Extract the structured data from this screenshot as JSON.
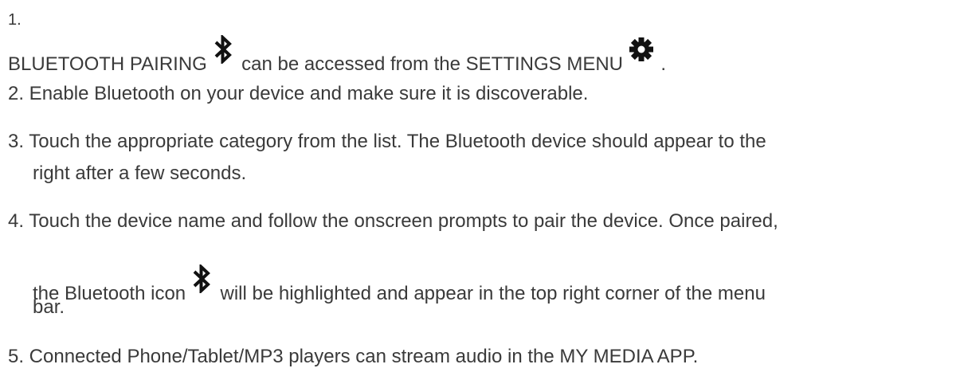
{
  "steps": [
    {
      "number": "1.",
      "text_a": "BLUETOOTH PAIRING",
      "icon_a": "bluetooth-icon",
      "text_b": "can be accessed from the SETTINGS MENU",
      "icon_b": "gear-icon",
      "text_c": "."
    },
    {
      "text": "2. Enable Bluetooth on your device and make sure it is discoverable."
    },
    {
      "line1": "3. Touch the appropriate category from the list. The Bluetooth device should appear to the",
      "line2": "right after a few seconds."
    },
    {
      "line1": "4. Touch the device name and follow the onscreen prompts to pair the device. Once paired,",
      "line2_a": "the Bluetooth icon",
      "icon": "bluetooth-icon",
      "line2_b": "will be highlighted and appear in the top right corner of the menu",
      "line3": "bar."
    },
    {
      "text": "5. Connected Phone/Tablet/MP3 players can stream audio in the MY MEDIA APP."
    }
  ],
  "colors": {
    "text": "#3a3a3a",
    "icon": "#111111",
    "background": "#ffffff"
  }
}
